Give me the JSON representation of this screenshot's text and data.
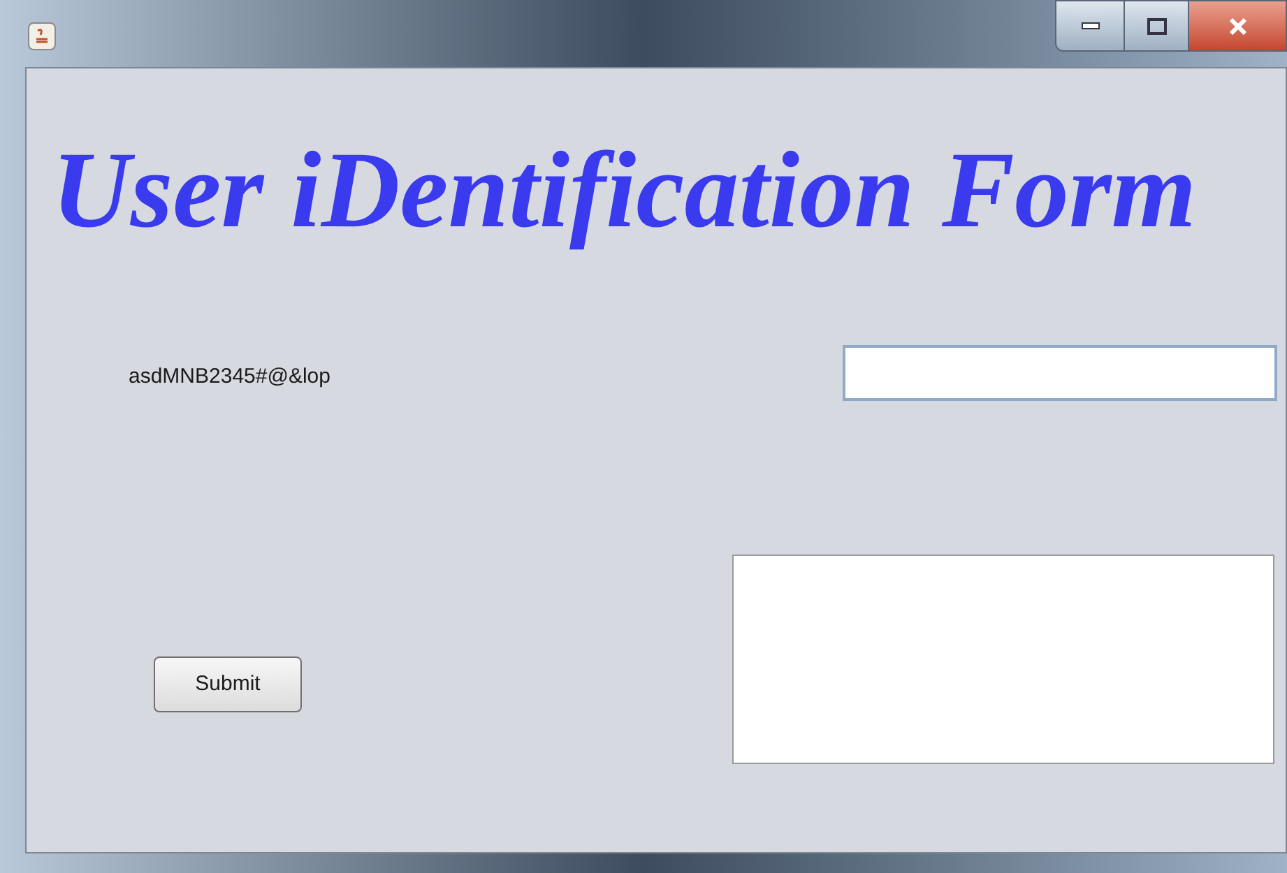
{
  "window": {
    "title_bar": {
      "buttons": [
        {
          "kind": "minimize"
        },
        {
          "kind": "maximize"
        },
        {
          "kind": "close"
        }
      ]
    }
  },
  "form": {
    "heading": "User iDentification Form",
    "label": "asdMNB2345#@&lop",
    "submit_button": "Submit"
  }
}
